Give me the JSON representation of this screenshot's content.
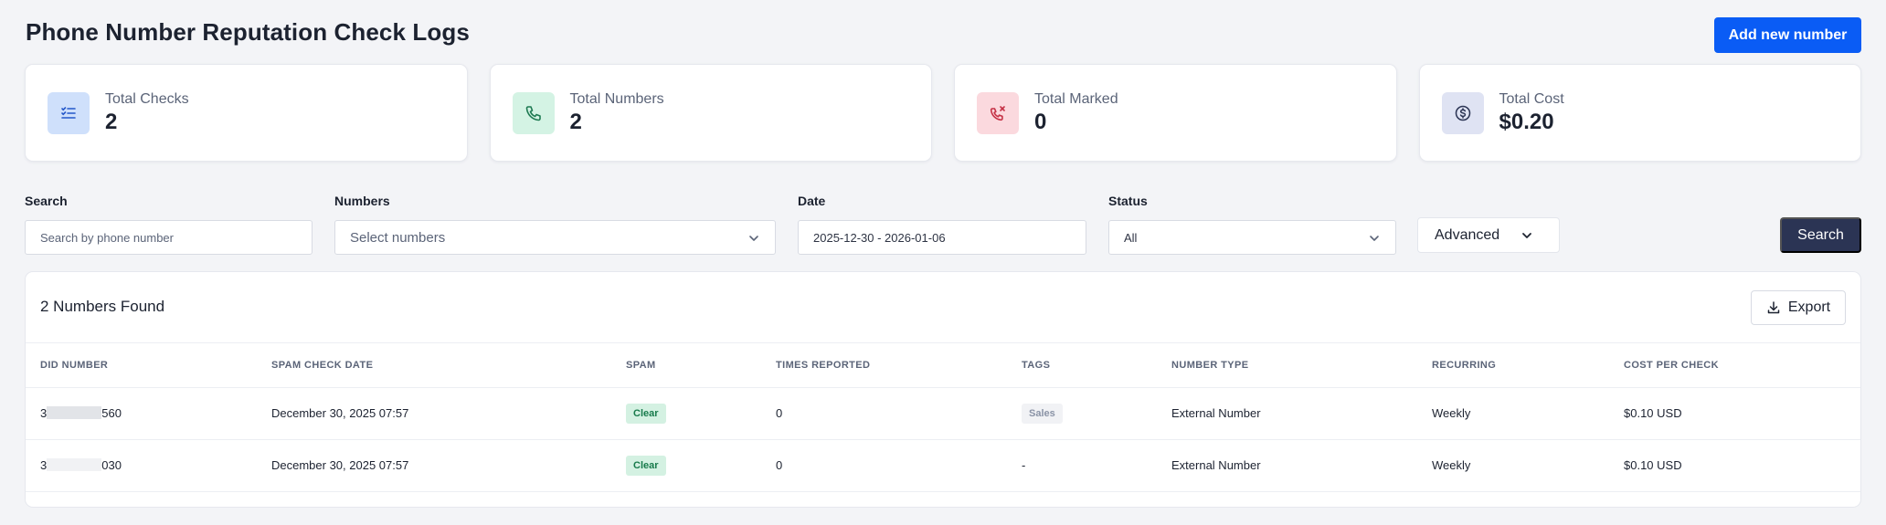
{
  "header": {
    "title": "Phone Number Reputation Check Logs",
    "add_button": "Add new number"
  },
  "stats": [
    {
      "label": "Total Checks",
      "value": "2",
      "icon": "checklist-icon",
      "bg": "#cfe0fb",
      "color": "#2458c9"
    },
    {
      "label": "Total Numbers",
      "value": "2",
      "icon": "phone-icon",
      "bg": "#d4f3e4",
      "color": "#1e7a52"
    },
    {
      "label": "Total Marked",
      "value": "0",
      "icon": "phone-x-icon",
      "bg": "#fbd9de",
      "color": "#c53145"
    },
    {
      "label": "Total Cost",
      "value": "$0.20",
      "icon": "dollar-icon",
      "bg": "#dfe3f3",
      "color": "#2b3454"
    }
  ],
  "filters": {
    "search_label": "Search",
    "search_placeholder": "Search by phone number",
    "numbers_label": "Numbers",
    "numbers_placeholder": "Select numbers",
    "date_label": "Date",
    "date_value": "2025-12-30 - 2026-01-06",
    "status_label": "Status",
    "status_value": "All",
    "advanced_label": "Advanced",
    "search_button": "Search"
  },
  "results": {
    "title": "2 Numbers Found",
    "export_label": "Export",
    "columns": [
      "DID NUMBER",
      "SPAM CHECK DATE",
      "SPAM",
      "TIMES REPORTED",
      "TAGS",
      "NUMBER TYPE",
      "RECURRING",
      "COST PER CHECK"
    ],
    "rows": [
      {
        "did_prefix": "3",
        "did_suffix": "560",
        "date": "December 30, 2025 07:57",
        "spam": "Clear",
        "times": "0",
        "tag": "Sales",
        "type": "External Number",
        "recurring": "Weekly",
        "cost": "$0.10 USD"
      },
      {
        "did_prefix": "3",
        "did_suffix": "030",
        "date": "December 30, 2025 07:57",
        "spam": "Clear",
        "times": "0",
        "tag": "-",
        "type": "External Number",
        "recurring": "Weekly",
        "cost": "$0.10 USD"
      }
    ]
  }
}
